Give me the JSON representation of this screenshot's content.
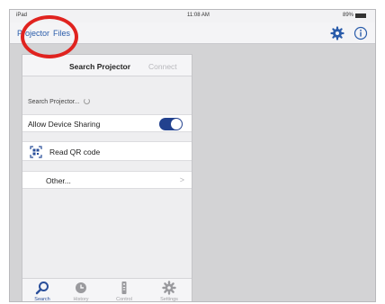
{
  "status_bar": {
    "device": "iPad",
    "time": "11:08 AM",
    "battery": "89%"
  },
  "nav": {
    "tabs": [
      "Projector",
      "Files"
    ]
  },
  "panel": {
    "header": {
      "title": "Search Projector",
      "secondary": "Connect"
    },
    "searching_text": "Search Projector...",
    "sharing_label": "Allow Device Sharing",
    "sharing_on": true,
    "qr_label": "Read QR code",
    "other_label": "Other...",
    "chevron": ">"
  },
  "tabbar": {
    "items": [
      {
        "label": "Search",
        "icon": "search-icon",
        "active": true
      },
      {
        "label": "History",
        "icon": "clock-icon",
        "active": false
      },
      {
        "label": "Control",
        "icon": "remote-icon",
        "active": false
      },
      {
        "label": "Settings",
        "icon": "gear-icon",
        "active": false
      }
    ]
  },
  "colors": {
    "accent": "#2a5caa",
    "toggle": "#22418e",
    "highlight_circle": "#e0231f",
    "background": "#d3d3d5"
  }
}
